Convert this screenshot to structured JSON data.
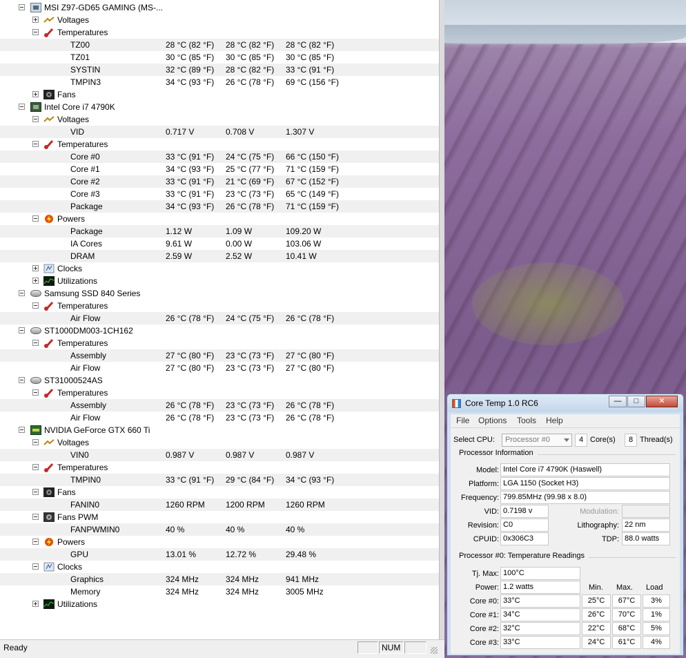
{
  "hwmonitor": {
    "rows": [
      {
        "level": 0,
        "kind": "device",
        "icon": "motherboard-icon",
        "label": "MSI Z97-GD65 GAMING (MS-...",
        "expander": "minus"
      },
      {
        "level": 1,
        "kind": "group",
        "icon": "voltage-icon",
        "label": "Voltages",
        "expander": "plus"
      },
      {
        "level": 1,
        "kind": "group",
        "icon": "thermometer-icon",
        "label": "Temperatures",
        "expander": "minus"
      },
      {
        "level": 2,
        "kind": "sensor",
        "label": "TZ00",
        "v1": "28 °C  (82 °F)",
        "v2": "28 °C  (82 °F)",
        "v3": "28 °C  (82 °F)",
        "stripe": true
      },
      {
        "level": 2,
        "kind": "sensor",
        "label": "TZ01",
        "v1": "30 °C  (85 °F)",
        "v2": "30 °C  (85 °F)",
        "v3": "30 °C  (85 °F)"
      },
      {
        "level": 2,
        "kind": "sensor",
        "label": "SYSTIN",
        "v1": "32 °C  (89 °F)",
        "v2": "28 °C  (82 °F)",
        "v3": "33 °C  (91 °F)",
        "stripe": true
      },
      {
        "level": 2,
        "kind": "sensor",
        "label": "TMPIN3",
        "v1": "34 °C  (93 °F)",
        "v2": "26 °C  (78 °F)",
        "v3": "69 °C  (156 °F)"
      },
      {
        "level": 1,
        "kind": "group",
        "icon": "fan-icon",
        "label": "Fans",
        "expander": "plus"
      },
      {
        "level": 0,
        "kind": "device",
        "icon": "cpu-icon",
        "label": "Intel Core i7 4790K",
        "expander": "minus"
      },
      {
        "level": 1,
        "kind": "group",
        "icon": "voltage-icon",
        "label": "Voltages",
        "expander": "minus"
      },
      {
        "level": 2,
        "kind": "sensor",
        "label": "VID",
        "v1": "0.717 V",
        "v2": "0.708 V",
        "v3": "1.307 V",
        "stripe": true
      },
      {
        "level": 1,
        "kind": "group",
        "icon": "thermometer-icon",
        "label": "Temperatures",
        "expander": "minus"
      },
      {
        "level": 2,
        "kind": "sensor",
        "label": "Core #0",
        "v1": "33 °C  (91 °F)",
        "v2": "24 °C  (75 °F)",
        "v3": "66 °C  (150 °F)",
        "stripe": true
      },
      {
        "level": 2,
        "kind": "sensor",
        "label": "Core #1",
        "v1": "34 °C  (93 °F)",
        "v2": "25 °C  (77 °F)",
        "v3": "71 °C  (159 °F)"
      },
      {
        "level": 2,
        "kind": "sensor",
        "label": "Core #2",
        "v1": "33 °C  (91 °F)",
        "v2": "21 °C  (69 °F)",
        "v3": "67 °C  (152 °F)",
        "stripe": true
      },
      {
        "level": 2,
        "kind": "sensor",
        "label": "Core #3",
        "v1": "33 °C  (91 °F)",
        "v2": "23 °C  (73 °F)",
        "v3": "65 °C  (149 °F)"
      },
      {
        "level": 2,
        "kind": "sensor",
        "label": "Package",
        "v1": "34 °C  (93 °F)",
        "v2": "26 °C  (78 °F)",
        "v3": "71 °C  (159 °F)",
        "stripe": true
      },
      {
        "level": 1,
        "kind": "group",
        "icon": "power-icon",
        "label": "Powers",
        "expander": "minus"
      },
      {
        "level": 2,
        "kind": "sensor",
        "label": "Package",
        "v1": "1.12 W",
        "v2": "1.09 W",
        "v3": "109.20 W",
        "stripe": true
      },
      {
        "level": 2,
        "kind": "sensor",
        "label": "IA Cores",
        "v1": "9.61 W",
        "v2": "0.00 W",
        "v3": "103.06 W"
      },
      {
        "level": 2,
        "kind": "sensor",
        "label": "DRAM",
        "v1": "2.59 W",
        "v2": "2.52 W",
        "v3": "10.41 W",
        "stripe": true
      },
      {
        "level": 1,
        "kind": "group",
        "icon": "clock-icon",
        "label": "Clocks",
        "expander": "plus"
      },
      {
        "level": 1,
        "kind": "group",
        "icon": "utilization-icon",
        "label": "Utilizations",
        "expander": "plus"
      },
      {
        "level": 0,
        "kind": "device",
        "icon": "disk-icon",
        "label": "Samsung SSD 840 Series",
        "expander": "minus"
      },
      {
        "level": 1,
        "kind": "group",
        "icon": "thermometer-icon",
        "label": "Temperatures",
        "expander": "minus"
      },
      {
        "level": 2,
        "kind": "sensor",
        "label": "Air Flow",
        "v1": "26 °C  (78 °F)",
        "v2": "24 °C  (75 °F)",
        "v3": "26 °C  (78 °F)",
        "stripe": true
      },
      {
        "level": 0,
        "kind": "device",
        "icon": "disk-icon",
        "label": "ST1000DM003-1CH162",
        "expander": "minus"
      },
      {
        "level": 1,
        "kind": "group",
        "icon": "thermometer-icon",
        "label": "Temperatures",
        "expander": "minus"
      },
      {
        "level": 2,
        "kind": "sensor",
        "label": "Assembly",
        "v1": "27 °C  (80 °F)",
        "v2": "23 °C  (73 °F)",
        "v3": "27 °C  (80 °F)",
        "stripe": true
      },
      {
        "level": 2,
        "kind": "sensor",
        "label": "Air Flow",
        "v1": "27 °C  (80 °F)",
        "v2": "23 °C  (73 °F)",
        "v3": "27 °C  (80 °F)"
      },
      {
        "level": 0,
        "kind": "device",
        "icon": "disk-icon",
        "label": "ST31000524AS",
        "expander": "minus"
      },
      {
        "level": 1,
        "kind": "group",
        "icon": "thermometer-icon",
        "label": "Temperatures",
        "expander": "minus"
      },
      {
        "level": 2,
        "kind": "sensor",
        "label": "Assembly",
        "v1": "26 °C  (78 °F)",
        "v2": "23 °C  (73 °F)",
        "v3": "26 °C  (78 °F)",
        "stripe": true
      },
      {
        "level": 2,
        "kind": "sensor",
        "label": "Air Flow",
        "v1": "26 °C  (78 °F)",
        "v2": "23 °C  (73 °F)",
        "v3": "26 °C  (78 °F)"
      },
      {
        "level": 0,
        "kind": "device",
        "icon": "gpu-icon",
        "label": "NVIDIA GeForce GTX 660 Ti",
        "expander": "minus"
      },
      {
        "level": 1,
        "kind": "group",
        "icon": "voltage-icon",
        "label": "Voltages",
        "expander": "minus"
      },
      {
        "level": 2,
        "kind": "sensor",
        "label": "VIN0",
        "v1": "0.987 V",
        "v2": "0.987 V",
        "v3": "0.987 V",
        "stripe": true
      },
      {
        "level": 1,
        "kind": "group",
        "icon": "thermometer-icon",
        "label": "Temperatures",
        "expander": "minus"
      },
      {
        "level": 2,
        "kind": "sensor",
        "label": "TMPIN0",
        "v1": "33 °C  (91 °F)",
        "v2": "29 °C  (84 °F)",
        "v3": "34 °C  (93 °F)",
        "stripe": true
      },
      {
        "level": 1,
        "kind": "group",
        "icon": "fan-icon",
        "label": "Fans",
        "expander": "minus"
      },
      {
        "level": 2,
        "kind": "sensor",
        "label": "FANIN0",
        "v1": "1260 RPM",
        "v2": "1200 RPM",
        "v3": "1260 RPM",
        "stripe": true
      },
      {
        "level": 1,
        "kind": "group",
        "icon": "fan-pwm-icon",
        "label": "Fans PWM",
        "expander": "minus"
      },
      {
        "level": 2,
        "kind": "sensor",
        "label": "FANPWMIN0",
        "v1": "40 %",
        "v2": "40 %",
        "v3": "40 %",
        "stripe": true
      },
      {
        "level": 1,
        "kind": "group",
        "icon": "power-icon",
        "label": "Powers",
        "expander": "minus"
      },
      {
        "level": 2,
        "kind": "sensor",
        "label": "GPU",
        "v1": "13.01 %",
        "v2": "12.72 %",
        "v3": "29.48 %",
        "stripe": true
      },
      {
        "level": 1,
        "kind": "group",
        "icon": "clock-icon",
        "label": "Clocks",
        "expander": "minus"
      },
      {
        "level": 2,
        "kind": "sensor",
        "label": "Graphics",
        "v1": "324 MHz",
        "v2": "324 MHz",
        "v3": "941 MHz",
        "stripe": true
      },
      {
        "level": 2,
        "kind": "sensor",
        "label": "Memory",
        "v1": "324 MHz",
        "v2": "324 MHz",
        "v3": "3005 MHz"
      },
      {
        "level": 1,
        "kind": "group",
        "icon": "utilization-icon",
        "label": "Utilizations",
        "expander": "plus"
      }
    ],
    "status": {
      "text": "Ready",
      "num_indicator": "NUM"
    }
  },
  "coretemp": {
    "title": "Core Temp 1.0 RC6",
    "menu": [
      "File",
      "Options",
      "Tools",
      "Help"
    ],
    "select_cpu_label": "Select CPU:",
    "selected_cpu": "Processor #0",
    "cores_count": "4",
    "cores_label": "Core(s)",
    "threads_count": "8",
    "threads_label": "Thread(s)",
    "proc_info_heading": "Processor Information",
    "model_label": "Model:",
    "model": "Intel Core i7 4790K (Haswell)",
    "platform_label": "Platform:",
    "platform": "LGA 1150 (Socket H3)",
    "frequency_label": "Frequency:",
    "frequency": "799.85MHz (99.98 x 8.0)",
    "vid_label": "VID:",
    "vid": "0.7198 v",
    "modulation_label": "Modulation:",
    "modulation": "",
    "revision_label": "Revision:",
    "revision": "C0",
    "lithography_label": "Lithography:",
    "lithography": "22 nm",
    "cpuid_label": "CPUID:",
    "cpuid": "0x306C3",
    "tdp_label": "TDP:",
    "tdp": "88.0 watts",
    "readings_heading": "Processor #0: Temperature Readings",
    "tjmax_label": "Tj. Max:",
    "tjmax": "100°C",
    "power_label": "Power:",
    "power": "1.2 watts",
    "col_min": "Min.",
    "col_max": "Max.",
    "col_load": "Load",
    "cores": [
      {
        "label": "Core #0:",
        "temp": "33°C",
        "min": "25°C",
        "max": "67°C",
        "load": "3%"
      },
      {
        "label": "Core #1:",
        "temp": "34°C",
        "min": "26°C",
        "max": "70°C",
        "load": "1%"
      },
      {
        "label": "Core #2:",
        "temp": "32°C",
        "min": "22°C",
        "max": "68°C",
        "load": "5%"
      },
      {
        "label": "Core #3:",
        "temp": "33°C",
        "min": "24°C",
        "max": "61°C",
        "load": "4%"
      }
    ]
  }
}
